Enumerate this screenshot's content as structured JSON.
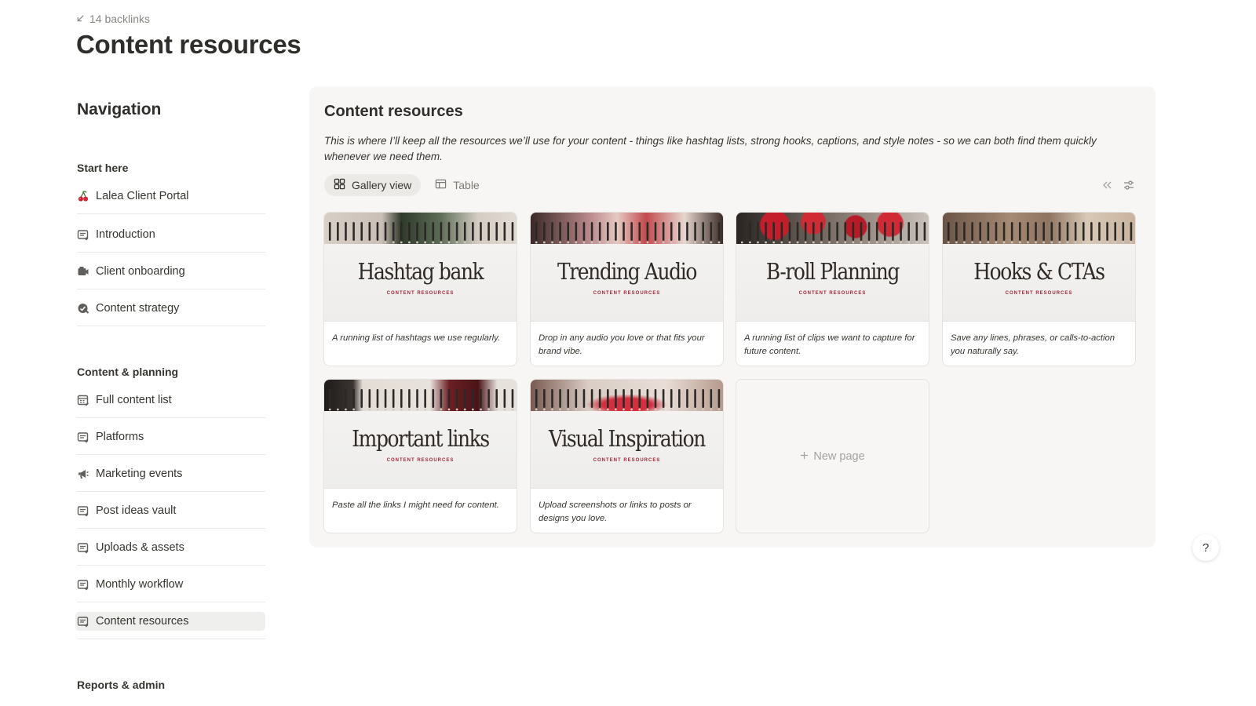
{
  "backlinks": {
    "icon": "arrow-down-left-icon",
    "label": "14 backlinks"
  },
  "page": {
    "title": "Content resources"
  },
  "navigation": {
    "heading": "Navigation",
    "sections": [
      {
        "label": "Start here",
        "items": [
          {
            "label": "Lalea Client Portal",
            "icon": "cherry-icon"
          },
          {
            "label": "Introduction",
            "icon": "page-icon"
          },
          {
            "label": "Client onboarding",
            "icon": "onboarding-icon"
          },
          {
            "label": "Content strategy",
            "icon": "strategy-icon"
          }
        ]
      },
      {
        "label": "Content & planning",
        "items": [
          {
            "label": "Full content list",
            "icon": "calendar-icon"
          },
          {
            "label": "Platforms",
            "icon": "page-icon"
          },
          {
            "label": "Marketing events",
            "icon": "megaphone-icon"
          },
          {
            "label": "Post ideas vault",
            "icon": "page-icon"
          },
          {
            "label": "Uploads & assets",
            "icon": "page-icon"
          },
          {
            "label": "Monthly workflow",
            "icon": "page-icon"
          },
          {
            "label": "Content resources",
            "icon": "page-icon",
            "active": true
          }
        ]
      },
      {
        "label": "Reports & admin",
        "items": []
      }
    ]
  },
  "panel": {
    "title": "Content resources",
    "description": "This is where I’ll keep all the resources we’ll use for your content - things like hashtag lists, strong hooks, captions, and style notes - so we can both find them quickly whenever we need them.",
    "views": [
      {
        "label": "Gallery view",
        "icon": "gallery-icon",
        "active": true
      },
      {
        "label": "Table",
        "icon": "table-icon",
        "active": false
      }
    ],
    "tools": [
      "collapse-icon",
      "settings-sliders-icon"
    ]
  },
  "gallery": {
    "cards": [
      {
        "cover_title": "Hashtag bank",
        "cover_subtitle": "CONTENT RESOURCES",
        "description": "A running list of hashtags we use regularly."
      },
      {
        "cover_title": "Trending Audio",
        "cover_subtitle": "CONTENT RESOURCES",
        "description": "Drop in any audio you love or that fits your brand vibe."
      },
      {
        "cover_title": "B-roll Planning",
        "cover_subtitle": "CONTENT RESOURCES",
        "description": "A running list of clips we want to capture for future content."
      },
      {
        "cover_title": "Hooks & CTAs",
        "cover_subtitle": "CONTENT RESOURCES",
        "description": "Save any lines, phrases, or calls-to-action you naturally say."
      },
      {
        "cover_title": "Important links",
        "cover_subtitle": "CONTENT RESOURCES",
        "description": "Paste all the links I might need for content."
      },
      {
        "cover_title": "Visual Inspiration",
        "cover_subtitle": "CONTENT RESOURCES",
        "description": "Upload screenshots or links to posts or designs you love."
      }
    ],
    "new_page": {
      "icon": "plus-icon",
      "label": "New page"
    }
  },
  "help": {
    "label": "?"
  },
  "colors": {
    "accent_subtitle": "#a3273a",
    "panel_bg": "#f7f6f4",
    "active_nav_bg": "#efefed"
  }
}
